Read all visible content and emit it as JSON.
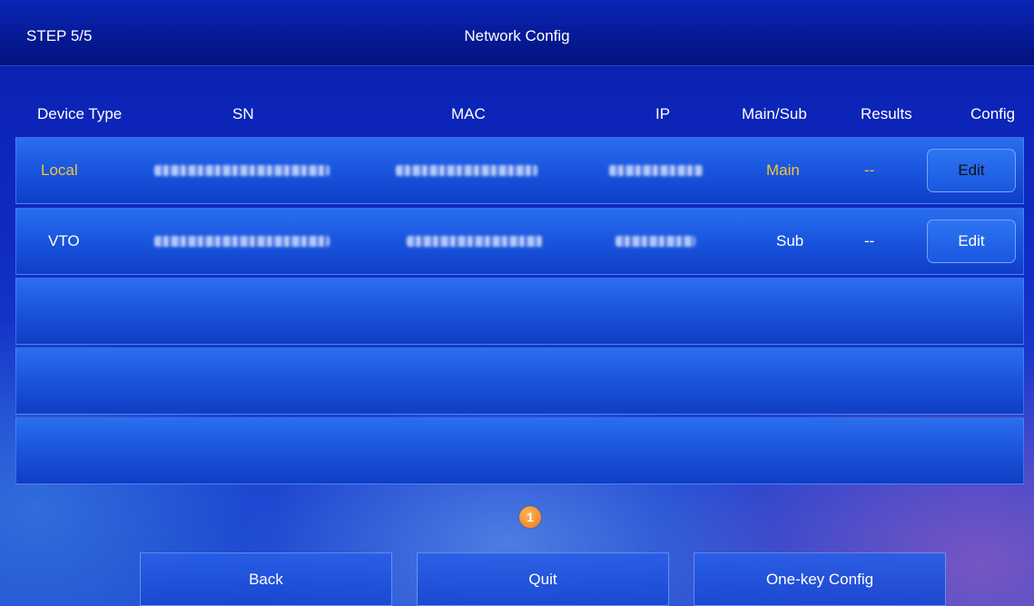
{
  "header": {
    "step": "STEP 5/5",
    "title": "Network Config"
  },
  "columns": [
    "Device Type",
    "SN",
    "MAC",
    "IP",
    "Main/Sub",
    "Results",
    "Config"
  ],
  "rows": [
    {
      "device_type": "Local",
      "mode": "Main",
      "result": "--",
      "action": "Edit"
    },
    {
      "device_type": "VTO",
      "mode": "Sub",
      "result": "--",
      "action": "Edit"
    }
  ],
  "pagination": {
    "current_page": "1"
  },
  "footer": {
    "back": "Back",
    "quit": "Quit",
    "one_key": "One-key Config"
  },
  "colors": {
    "highlight_text": "#f3c33a",
    "page_badge": "#f07a10"
  }
}
